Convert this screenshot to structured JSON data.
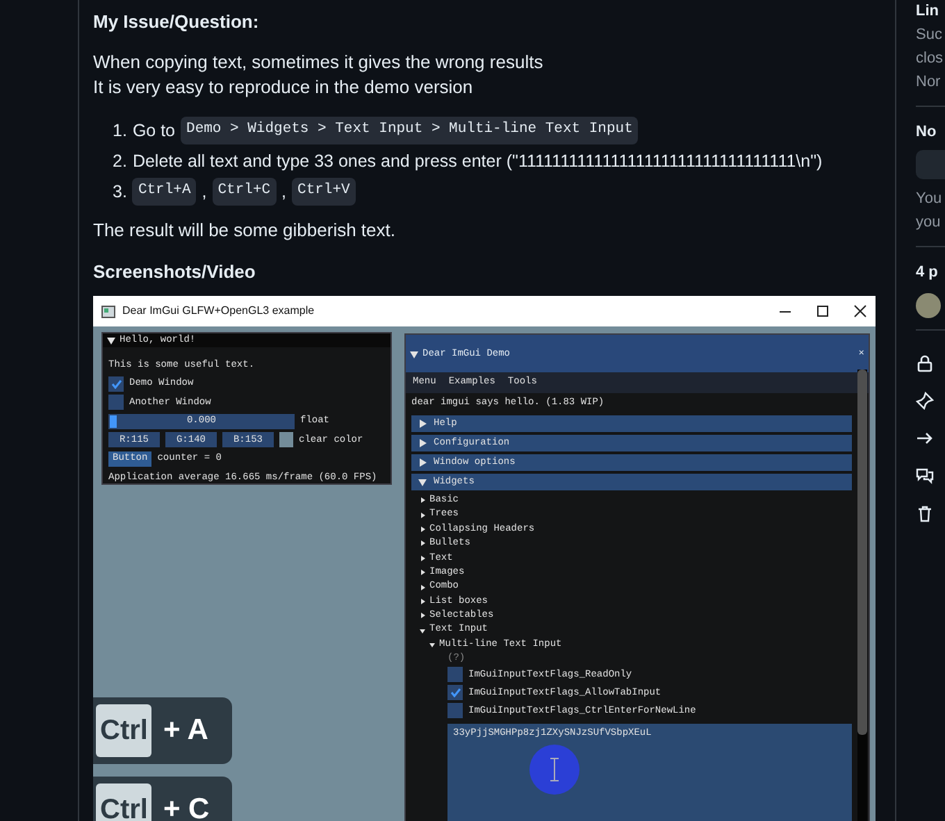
{
  "issue": {
    "heading": "My Issue/Question:",
    "paragraph_lines": [
      "When copying text, sometimes it gives the wrong results",
      "It is very easy to reproduce in the demo version"
    ],
    "steps": [
      {
        "number": "1.",
        "parts": [
          {
            "kind": "text",
            "text": "Go to"
          },
          {
            "kind": "code",
            "text": "Demo > Widgets > Text Input > Multi-line Text Input"
          }
        ]
      },
      {
        "number": "2.",
        "parts": [
          {
            "kind": "text",
            "text": "Delete all text and type 33 ones and press enter (\"111111111111111111111111111111111\\n\")"
          }
        ]
      },
      {
        "number": "3.",
        "parts": [
          {
            "kind": "code",
            "text": "Ctrl+A"
          },
          {
            "kind": "text",
            "text": ","
          },
          {
            "kind": "code",
            "text": "Ctrl+C"
          },
          {
            "kind": "text",
            "text": ","
          },
          {
            "kind": "code",
            "text": "Ctrl+V"
          }
        ]
      }
    ],
    "result": "The result will be some gibberish text.",
    "media_heading": "Screenshots/Video"
  },
  "screenshot": {
    "window_title": "Dear ImGui GLFW+OpenGL3 example",
    "hello_window": {
      "title": "Hello, world!",
      "expanded": true,
      "text": "This is some useful text.",
      "checkboxes": [
        {
          "label": "Demo Window",
          "checked": true
        },
        {
          "label": "Another Window",
          "checked": false
        }
      ],
      "slider": {
        "reading": "0.000",
        "level": 0,
        "label": "float"
      },
      "color_fields": [
        "R:115",
        "G:140",
        "B:153"
      ],
      "color_label": "clear color",
      "button": "Button",
      "counter": "counter = 0",
      "stats": "Application average 16.665 ms/frame (60.0 FPS)"
    },
    "demo_window": {
      "title": "Dear ImGui Demo",
      "expanded": true,
      "close": "×",
      "menu": [
        "Menu",
        "Examples",
        "Tools"
      ],
      "greeting": "dear imgui says hello. (1.83 WIP)",
      "headers": [
        {
          "label": "Help",
          "expanded": false
        },
        {
          "label": "Configuration",
          "expanded": false
        },
        {
          "label": "Window options",
          "expanded": false
        },
        {
          "label": "Widgets",
          "expanded": true
        }
      ],
      "widgets": [
        {
          "label": "Basic",
          "expanded": false
        },
        {
          "label": "Trees",
          "expanded": false
        },
        {
          "label": "Collapsing Headers",
          "expanded": false
        },
        {
          "label": "Bullets",
          "expanded": false
        },
        {
          "label": "Text",
          "expanded": false
        },
        {
          "label": "Images",
          "expanded": false
        },
        {
          "label": "Combo",
          "expanded": false
        },
        {
          "label": "List boxes",
          "expanded": false
        },
        {
          "label": "Selectables",
          "expanded": false
        },
        {
          "label": "Text Input",
          "expanded": true,
          "children": [
            {
              "label": "Multi-line Text Input",
              "expanded": true
            }
          ]
        }
      ],
      "help_marker": "(?)",
      "flags": [
        {
          "label": "ImGuiInputTextFlags_ReadOnly",
          "checked": false
        },
        {
          "label": "ImGuiInputTextFlags_AllowTabInput",
          "checked": true
        },
        {
          "label": "ImGuiInputTextFlags_CtrlEnterForNewLine",
          "checked": false
        }
      ],
      "text_value": "33yPjjSMGHPp8zj1ZXySNJzSUfVSbpXEuL"
    },
    "key_overlays": [
      {
        "key": "Ctrl",
        "combo": "+ A"
      },
      {
        "key": "Ctrl",
        "combo": "+ C"
      }
    ]
  },
  "sidebar": {
    "sections": [
      {
        "lines": [
          "Lin",
          "Suc",
          "clos",
          "Nor"
        ]
      },
      {
        "lines": [
          "No"
        ],
        "button": true,
        "after": [
          "You",
          "you"
        ]
      },
      {
        "lines": [
          "4 p"
        ],
        "avatar": true
      }
    ],
    "actions": [
      {
        "kind": "lock"
      },
      {
        "kind": "pin"
      },
      {
        "kind": "arrow"
      },
      {
        "kind": "comments"
      },
      {
        "kind": "trash"
      }
    ]
  }
}
